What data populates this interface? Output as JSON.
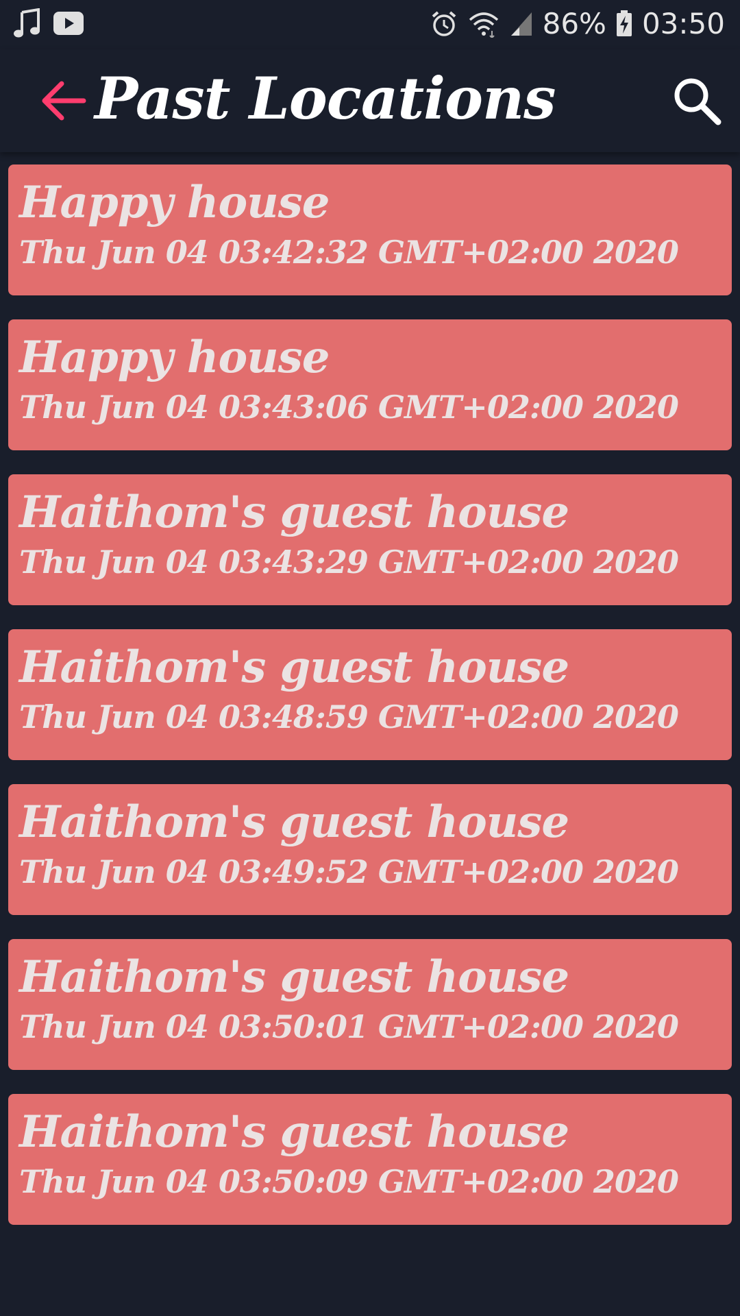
{
  "status_bar": {
    "left_icons": [
      "music-note-icon",
      "youtube-icon"
    ],
    "right_icons": [
      "alarm-icon",
      "wifi-icon",
      "signal-icon",
      "battery-charging-icon"
    ],
    "battery": "86%",
    "time": "03:50"
  },
  "app_bar": {
    "title": "Past Locations",
    "back_icon": "arrow-left-icon",
    "search_icon": "search-icon",
    "accent_color": "#ff3d6e"
  },
  "colors": {
    "background": "#191e2b",
    "card": "#e26e6e",
    "card_text": "#ebe3e3"
  },
  "locations": [
    {
      "name": "Happy house",
      "date": "Thu Jun 04 03:42:32 GMT+02:00 2020"
    },
    {
      "name": "Happy house",
      "date": "Thu Jun 04 03:43:06 GMT+02:00 2020"
    },
    {
      "name": "Haithom's guest house",
      "date": "Thu Jun 04 03:43:29 GMT+02:00 2020"
    },
    {
      "name": "Haithom's guest house",
      "date": "Thu Jun 04 03:48:59 GMT+02:00 2020"
    },
    {
      "name": "Haithom's guest house",
      "date": "Thu Jun 04 03:49:52 GMT+02:00 2020"
    },
    {
      "name": "Haithom's guest house",
      "date": "Thu Jun 04 03:50:01 GMT+02:00 2020"
    },
    {
      "name": "Haithom's guest house",
      "date": "Thu Jun 04 03:50:09 GMT+02:00 2020"
    }
  ]
}
